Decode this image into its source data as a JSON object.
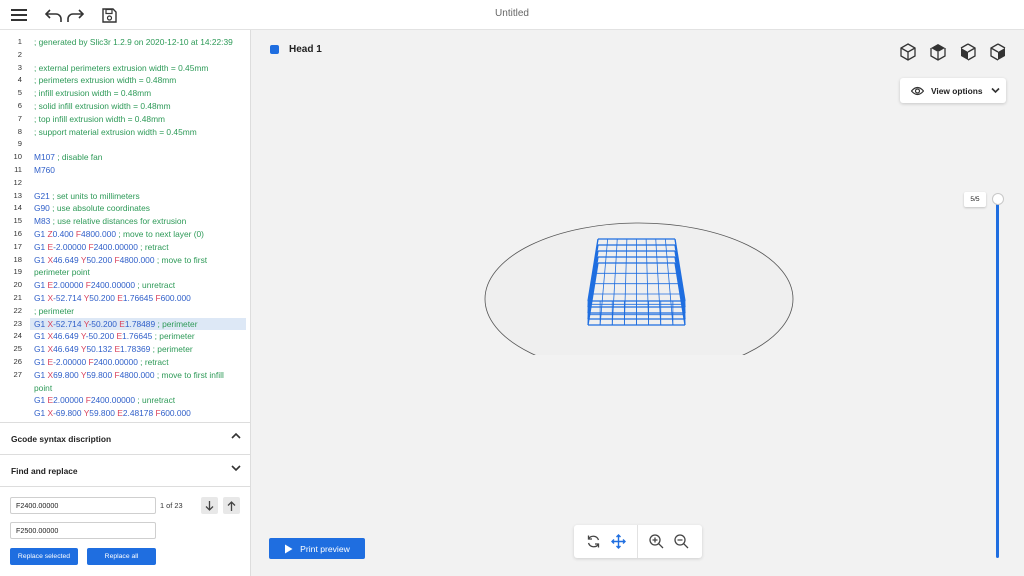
{
  "topbar": {
    "title": "Untitled"
  },
  "code": {
    "line_numbers": [
      "1",
      "2",
      "3",
      "4",
      "5",
      "6",
      "7",
      "8",
      "9",
      "10",
      "11",
      "12",
      "13",
      "14",
      "15",
      "16",
      "17",
      "18",
      "19",
      "20",
      "21",
      "22",
      "23",
      "24",
      "25",
      "26",
      "27"
    ],
    "lines": [
      [
        {
          "t": "; generated by Slic3r 1.2.9 on 2020-12-10 at 14:22:39",
          "c": "c"
        }
      ],
      [],
      [
        {
          "t": "; external perimeters extrusion width = 0.45mm",
          "c": "c"
        }
      ],
      [
        {
          "t": "; perimeters extrusion width = 0.48mm",
          "c": "c"
        }
      ],
      [
        {
          "t": "; infill extrusion width = 0.48mm",
          "c": "c"
        }
      ],
      [
        {
          "t": "; solid infill extrusion width = 0.48mm",
          "c": "c"
        }
      ],
      [
        {
          "t": "; top infill extrusion width = 0.48mm",
          "c": "c"
        }
      ],
      [
        {
          "t": "; support material extrusion width = 0.45mm",
          "c": "c"
        }
      ],
      [],
      [
        {
          "t": "M107",
          "c": "k"
        },
        {
          "t": " ; disable fan",
          "c": "c"
        }
      ],
      [
        {
          "t": "M760",
          "c": "k"
        }
      ],
      [],
      [
        {
          "t": "G21",
          "c": "k"
        },
        {
          "t": " ; set units to millimeters",
          "c": "c"
        }
      ],
      [
        {
          "t": "G90",
          "c": "k"
        },
        {
          "t": " ; use absolute coordinates",
          "c": "c"
        }
      ],
      [
        {
          "t": "M83",
          "c": "k"
        },
        {
          "t": " ; use relative distances for extrusion",
          "c": "c"
        }
      ],
      [
        {
          "t": "G1 ",
          "c": "k"
        },
        {
          "t": "Z",
          "c": "p"
        },
        {
          "t": "0.400 ",
          "c": "n"
        },
        {
          "t": "F",
          "c": "p"
        },
        {
          "t": "4800.000",
          "c": "n"
        },
        {
          "t": " ; move to next layer (0)",
          "c": "c"
        }
      ],
      [
        {
          "t": "G1 ",
          "c": "k"
        },
        {
          "t": "E",
          "c": "p"
        },
        {
          "t": "-2.00000 ",
          "c": "n"
        },
        {
          "t": "F",
          "c": "p"
        },
        {
          "t": "2400.00000",
          "c": "n"
        },
        {
          "t": " ; retract",
          "c": "c"
        }
      ],
      [
        {
          "t": "G1 ",
          "c": "k"
        },
        {
          "t": "X",
          "c": "p"
        },
        {
          "t": "46.649 ",
          "c": "n"
        },
        {
          "t": "Y",
          "c": "p"
        },
        {
          "t": "50.200 ",
          "c": "n"
        },
        {
          "t": "F",
          "c": "p"
        },
        {
          "t": "4800.000",
          "c": "n"
        },
        {
          "t": " ; move to first",
          "c": "c"
        }
      ],
      [
        {
          "t": "perimeter point",
          "c": "c"
        }
      ],
      [
        {
          "t": "G1 ",
          "c": "k"
        },
        {
          "t": "E",
          "c": "p"
        },
        {
          "t": "2.00000 ",
          "c": "n"
        },
        {
          "t": "F",
          "c": "p"
        },
        {
          "t": "2400.00000",
          "c": "n"
        },
        {
          "t": " ; unretract",
          "c": "c"
        }
      ],
      [
        {
          "t": "G1 ",
          "c": "k"
        },
        {
          "t": "X",
          "c": "p"
        },
        {
          "t": "-52.714 ",
          "c": "n"
        },
        {
          "t": "Y",
          "c": "p"
        },
        {
          "t": "50.200 ",
          "c": "n"
        },
        {
          "t": "E",
          "c": "p"
        },
        {
          "t": "1.76645 ",
          "c": "n"
        },
        {
          "t": "F",
          "c": "p"
        },
        {
          "t": "600.000",
          "c": "n"
        }
      ],
      [
        {
          "t": "; perimeter",
          "c": "c"
        }
      ],
      [
        {
          "t": "G1 ",
          "c": "k"
        },
        {
          "t": "X",
          "c": "p"
        },
        {
          "t": "-52.714 ",
          "c": "n"
        },
        {
          "t": "Y",
          "c": "p"
        },
        {
          "t": "-50.200 ",
          "c": "n"
        },
        {
          "t": "E",
          "c": "p"
        },
        {
          "t": "1.78489",
          "c": "n"
        },
        {
          "t": " ; perimeter",
          "c": "c"
        }
      ],
      [
        {
          "t": "G1 ",
          "c": "k"
        },
        {
          "t": "X",
          "c": "p"
        },
        {
          "t": "46.649 ",
          "c": "n"
        },
        {
          "t": "Y",
          "c": "p"
        },
        {
          "t": "-50.200 ",
          "c": "n"
        },
        {
          "t": "E",
          "c": "p"
        },
        {
          "t": "1.76645",
          "c": "n"
        },
        {
          "t": " ; perimeter",
          "c": "c"
        }
      ],
      [
        {
          "t": "G1 ",
          "c": "k"
        },
        {
          "t": "X",
          "c": "p"
        },
        {
          "t": "46.649 ",
          "c": "n"
        },
        {
          "t": "Y",
          "c": "p"
        },
        {
          "t": "50.132 ",
          "c": "n"
        },
        {
          "t": "E",
          "c": "p"
        },
        {
          "t": "1.78369",
          "c": "n"
        },
        {
          "t": " ; perimeter",
          "c": "c"
        }
      ],
      [
        {
          "t": "G1 ",
          "c": "k"
        },
        {
          "t": "E",
          "c": "p"
        },
        {
          "t": "-2.00000 ",
          "c": "n"
        },
        {
          "t": "F",
          "c": "p"
        },
        {
          "t": "2400.00000",
          "c": "n"
        },
        {
          "t": " ; retract",
          "c": "c"
        }
      ],
      [
        {
          "t": "G1 ",
          "c": "k"
        },
        {
          "t": "X",
          "c": "p"
        },
        {
          "t": "69.800 ",
          "c": "n"
        },
        {
          "t": "Y",
          "c": "p"
        },
        {
          "t": "59.800 ",
          "c": "n"
        },
        {
          "t": "F",
          "c": "p"
        },
        {
          "t": "4800.000",
          "c": "n"
        },
        {
          "t": " ; move to first infill",
          "c": "c"
        }
      ],
      [
        {
          "t": "point",
          "c": "c"
        }
      ],
      [
        {
          "t": "G1 ",
          "c": "k"
        },
        {
          "t": "E",
          "c": "p"
        },
        {
          "t": "2.00000 ",
          "c": "n"
        },
        {
          "t": "F",
          "c": "p"
        },
        {
          "t": "2400.00000",
          "c": "n"
        },
        {
          "t": " ; unretract",
          "c": "c"
        }
      ],
      [
        {
          "t": "G1 ",
          "c": "k"
        },
        {
          "t": "X",
          "c": "p"
        },
        {
          "t": "-69.800 ",
          "c": "n"
        },
        {
          "t": "Y",
          "c": "p"
        },
        {
          "t": "59.800 ",
          "c": "n"
        },
        {
          "t": "E",
          "c": "p"
        },
        {
          "t": "2.48178 ",
          "c": "n"
        },
        {
          "t": "F",
          "c": "p"
        },
        {
          "t": "600.000",
          "c": "n"
        }
      ]
    ],
    "highlighted_line": 22
  },
  "panels": {
    "syntax_title": "Gcode syntax discription",
    "find_title": "Find and replace"
  },
  "find": {
    "find_value": "F2400.00000",
    "match_count": "1 of 23",
    "replace_value": "F2500.00000",
    "replace_selected": "Replace selected",
    "replace_all": "Replace all"
  },
  "viewer": {
    "head_label": "Head 1",
    "view_options": "View options",
    "layer_indicator": "5/5",
    "print_preview": "Print preview"
  },
  "colors": {
    "accent": "#1f6ee0",
    "comment": "#2e9a58",
    "keyword": "#2f5fc9",
    "param": "#d8405a"
  }
}
